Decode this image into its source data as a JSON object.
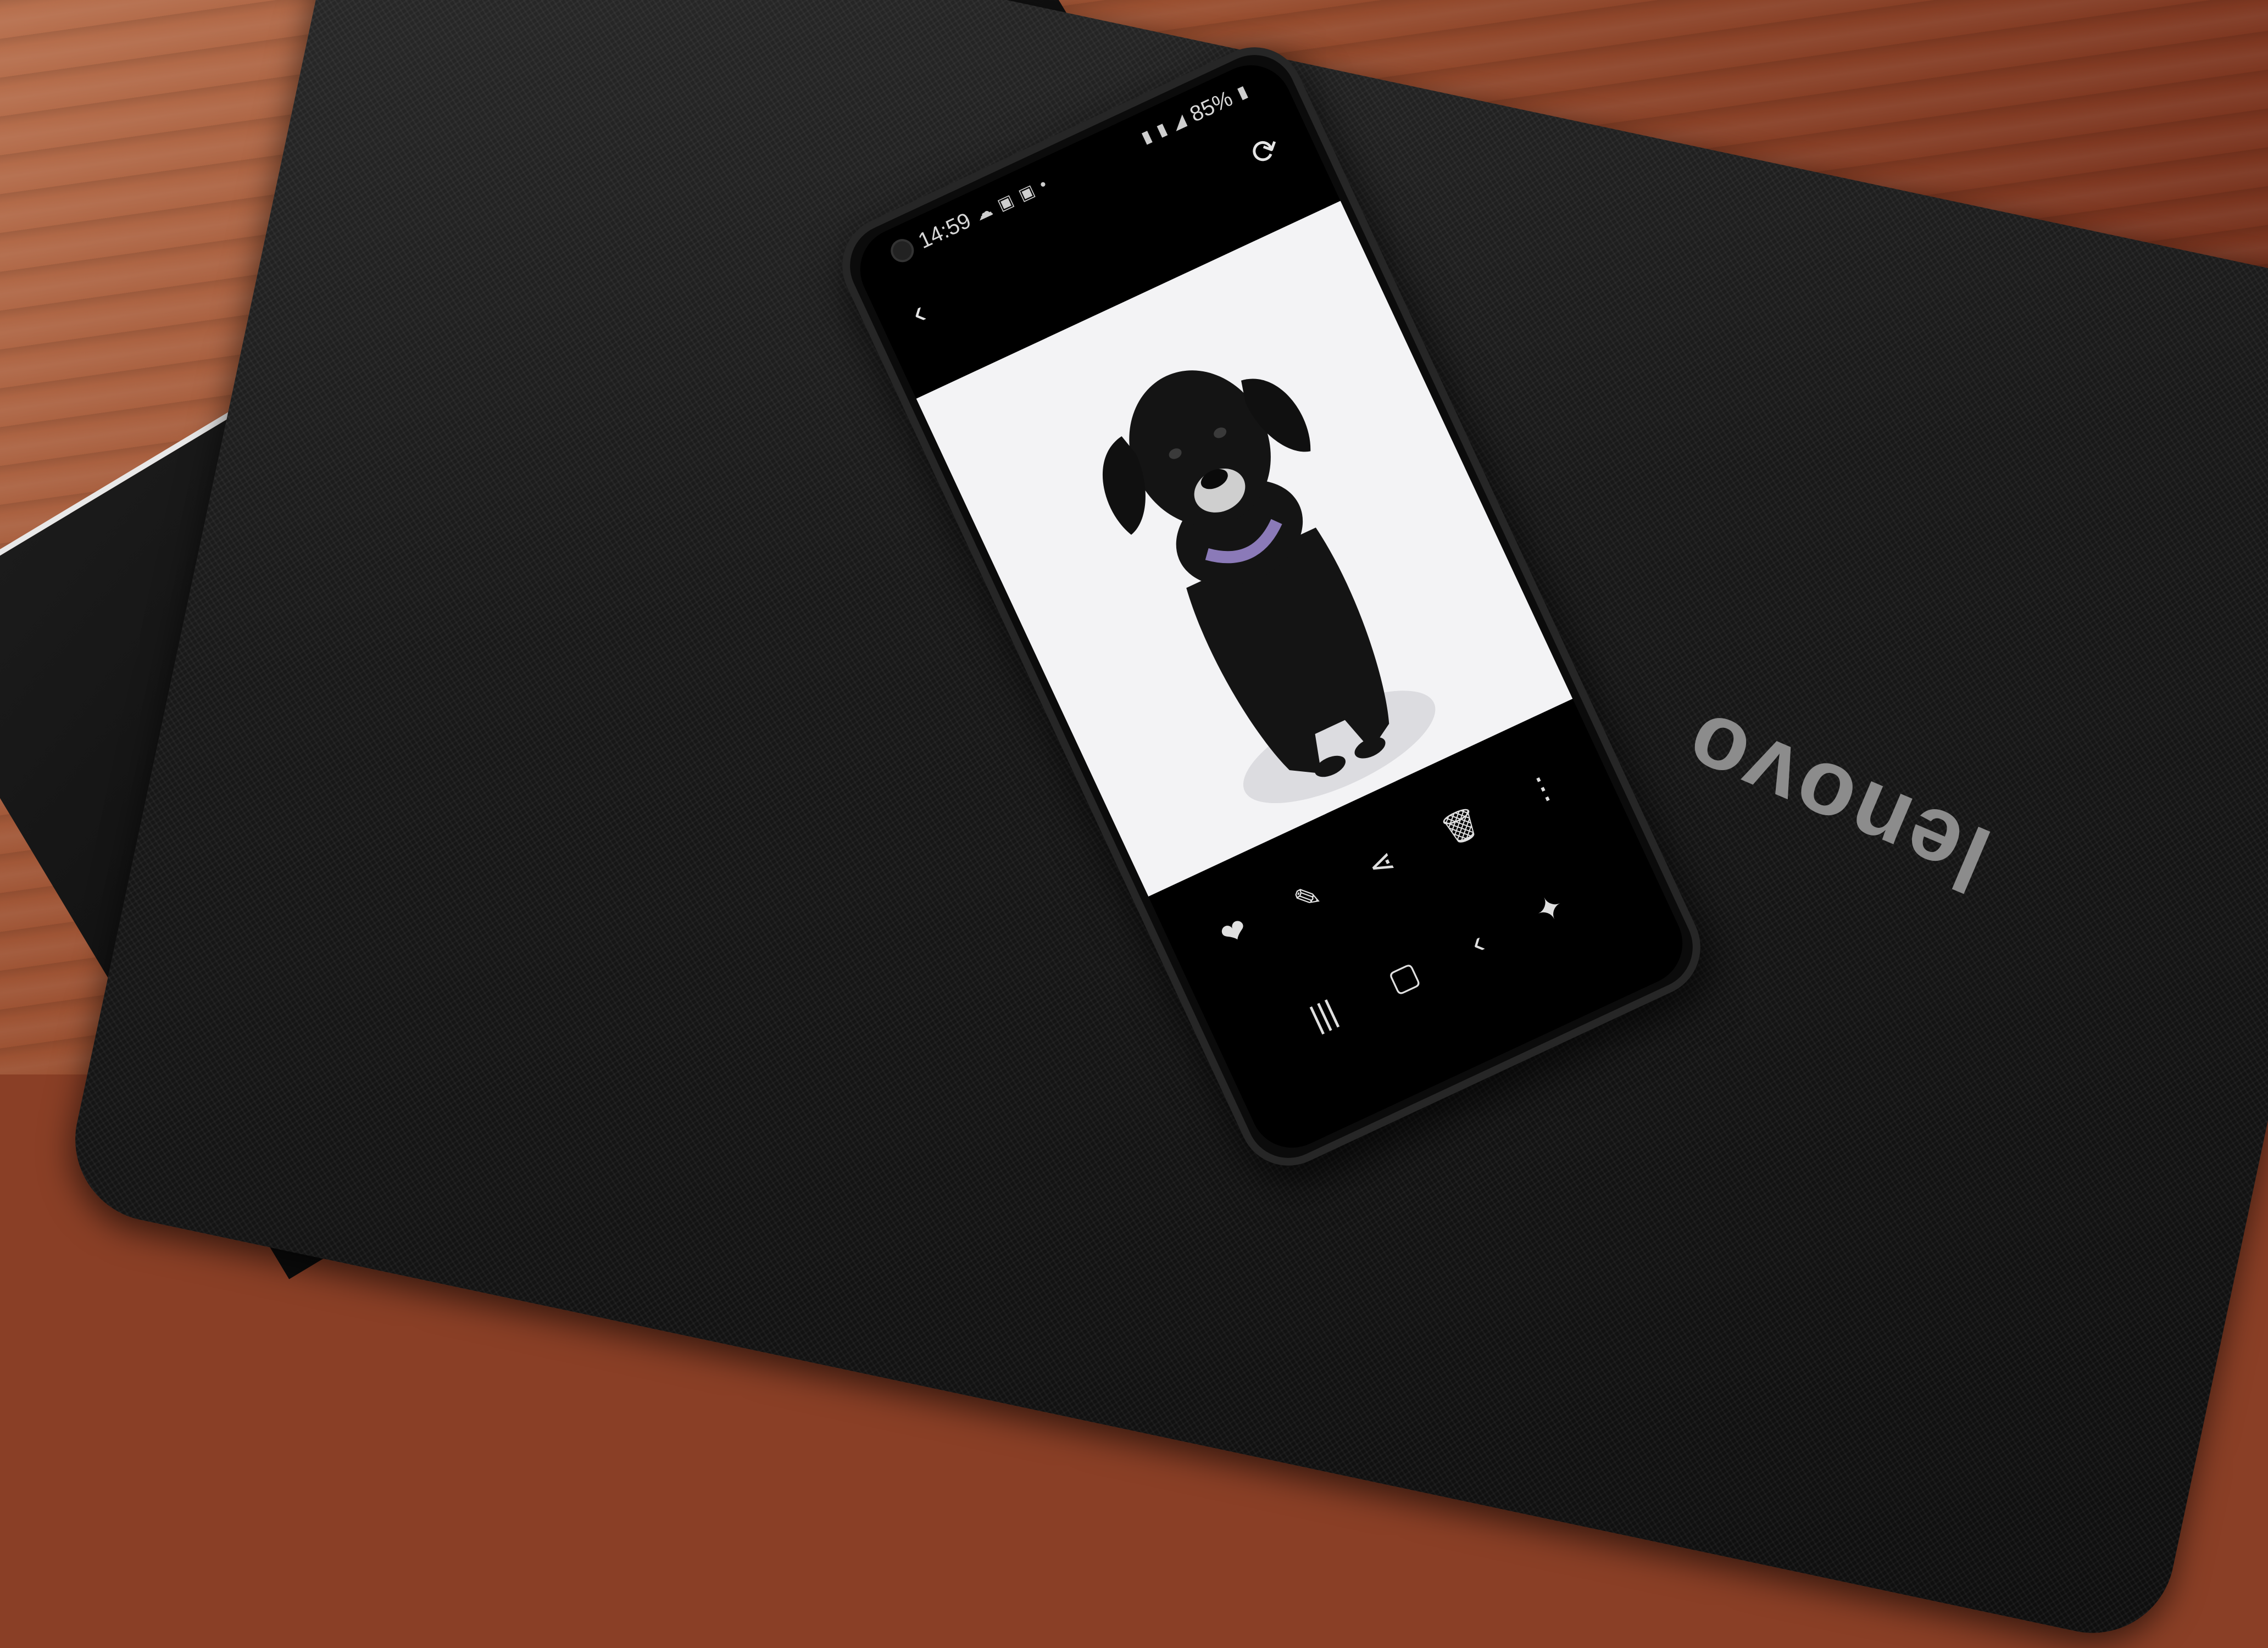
{
  "scene": {
    "laptop_brand": "lenovo"
  },
  "phone": {
    "status_bar": {
      "time": "14:59",
      "battery": "85%",
      "left_icons": [
        "cloud-icon",
        "notification-icon",
        "notification-icon",
        "dot-icon"
      ],
      "right_icons": [
        "sim-icon",
        "sim-icon",
        "signal-icon",
        "battery-icon"
      ]
    },
    "top_bar": {
      "back_icon": "‹",
      "remaster_icon": "⟳"
    },
    "toolbar": {
      "icons": [
        "❤",
        "✎",
        "⋖",
        "🗑",
        "⋮"
      ]
    },
    "nav_bar": {
      "icons": [
        "|||",
        "▢",
        "‹",
        "✦"
      ]
    }
  },
  "colors": {
    "desk": "#9a4f30",
    "laptop": "#151515",
    "screen_bg": "#000000",
    "photo_bg": "#f3f3f5",
    "dog": "#141414",
    "collar": "#8b7ab8"
  }
}
